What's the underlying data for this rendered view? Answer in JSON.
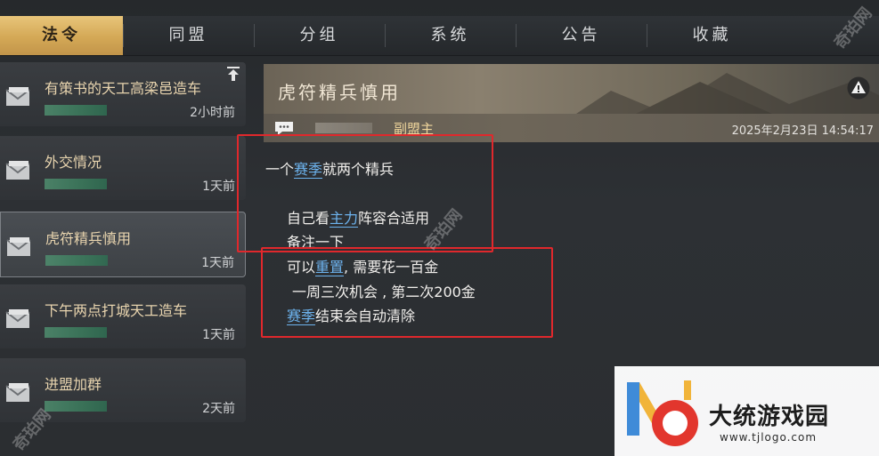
{
  "tabs": [
    {
      "label": "法令",
      "active": true
    },
    {
      "label": "同盟",
      "active": false
    },
    {
      "label": "分组",
      "active": false
    },
    {
      "label": "系统",
      "active": false
    },
    {
      "label": "公告",
      "active": false
    },
    {
      "label": "收藏",
      "active": false
    }
  ],
  "messages": [
    {
      "title": "有策书的天工高梁邑造车",
      "time": "2小时前",
      "pinned": true
    },
    {
      "title": "外交情况",
      "time": "1天前"
    },
    {
      "title": "虎符精兵慎用",
      "time": "1天前",
      "selected": true
    },
    {
      "title": "下午两点打城天工造车",
      "time": "1天前"
    },
    {
      "title": "进盟加群",
      "time": "2天前"
    }
  ],
  "detail": {
    "title": "虎符精兵慎用",
    "role": "副盟主",
    "datetime": "2025年2月23日 14:54:17",
    "body": {
      "l1_a": "一个",
      "l1_kw": "赛季",
      "l1_b": "就两个精兵",
      "l2_a": "自己看",
      "l2_kw": "主力",
      "l2_b": "阵容合适用",
      "l3": "备注一下",
      "l4_a": "可以",
      "l4_kw": "重置",
      "l4_b": ", 需要花一百金",
      "l5": "一周三次机会 , 第二次200金",
      "l6_kw": "赛季",
      "l6_b": "结束会自动清除"
    }
  },
  "watermark": {
    "logo_text": "大统游戏园",
    "url": "www.tjlogo.com",
    "side_text": "奇珀网"
  },
  "colors": {
    "accent_gold": "#d4a856",
    "keyword_blue": "#6db3ee",
    "annotation_red": "#e0282c"
  }
}
